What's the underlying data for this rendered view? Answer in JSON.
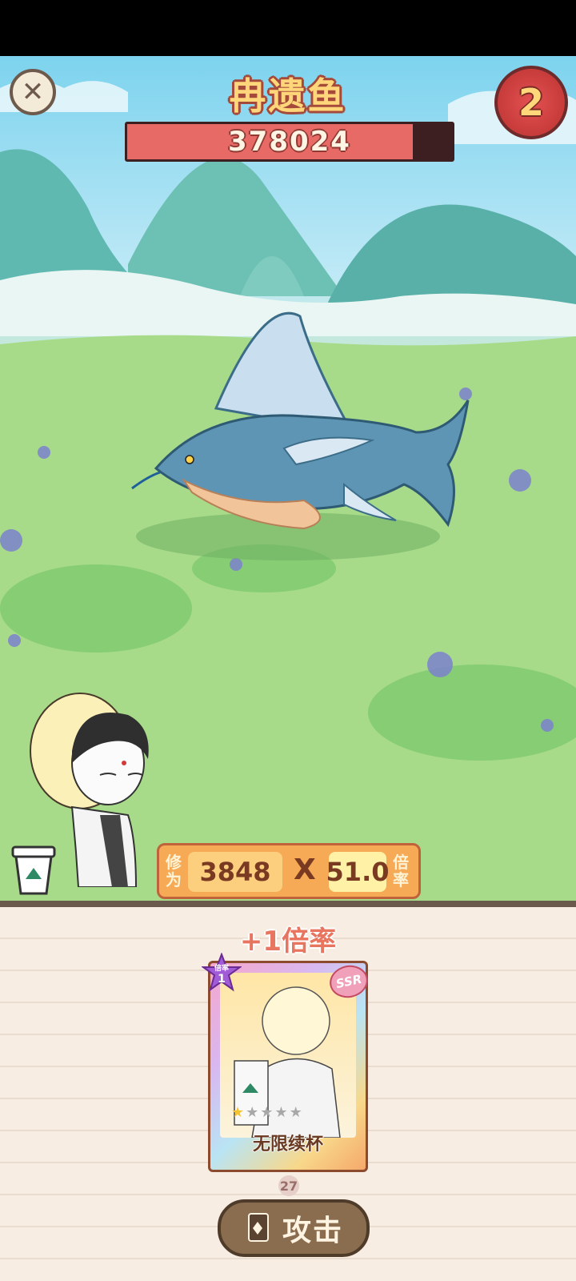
{
  "boss": {
    "name": "冉遗鱼",
    "hp_value": "378024",
    "hp_fraction": 0.88
  },
  "round_timer": {
    "value": "2"
  },
  "stats": {
    "cultivation_label_1": "修",
    "cultivation_label_2": "为",
    "cultivation_value": "3848",
    "multiply_sign": "X",
    "rate_value": "51.0",
    "rate_label_1": "倍",
    "rate_label_2": "率"
  },
  "bonus": {
    "text": "+1倍率"
  },
  "card": {
    "name": "无限续杯",
    "rank_label": "倍率",
    "rank_value": "1",
    "rarity": "SSR",
    "stars_filled": 1,
    "stars_total": 5,
    "count": "27"
  },
  "attack_button": {
    "label": "攻击"
  },
  "icons": {
    "close": "close-icon",
    "timer": "timer-icon",
    "cup": "cup-icon",
    "attack": "card-icon"
  },
  "colors": {
    "hp_fill": "#e86a66",
    "title": "#ffd77a",
    "stats_panel": "#f6aa55",
    "attack_button": "#8a6d4e"
  }
}
